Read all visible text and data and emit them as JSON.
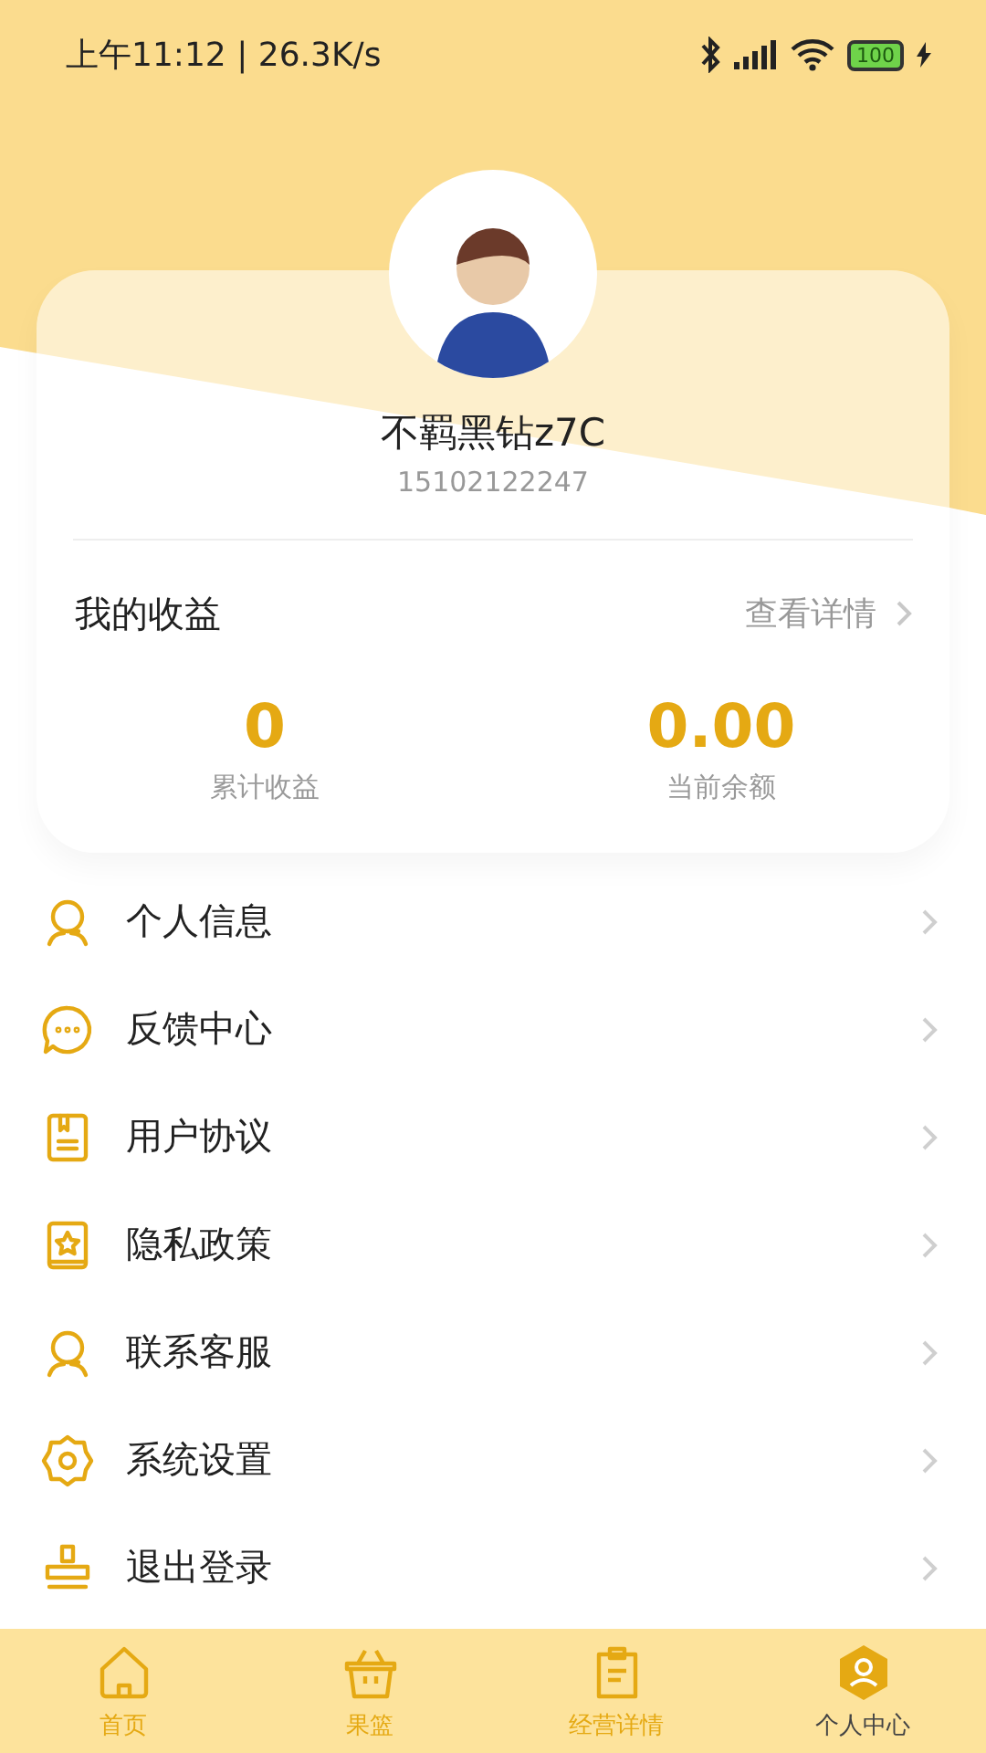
{
  "status_bar": {
    "time": "上午11:12 | 26.3K/s",
    "battery": "100"
  },
  "profile": {
    "name": "不羁黑钻z7C",
    "phone": "15102122247"
  },
  "earnings": {
    "title": "我的收益",
    "link": "查看详情",
    "stats": [
      {
        "value": "0",
        "label": "累计收益"
      },
      {
        "value": "0.00",
        "label": "当前余额"
      }
    ]
  },
  "menu": [
    {
      "kind": "person",
      "label": "个人信息"
    },
    {
      "kind": "chat",
      "label": "反馈中心"
    },
    {
      "kind": "doc",
      "label": "用户协议"
    },
    {
      "kind": "star",
      "label": "隐私政策"
    },
    {
      "kind": "person",
      "label": "联系客服"
    },
    {
      "kind": "gear",
      "label": "系统设置"
    },
    {
      "kind": "stamp",
      "label": "退出登录"
    }
  ],
  "tabs": [
    {
      "kind": "home",
      "label": "首页",
      "selected": false
    },
    {
      "kind": "basket",
      "label": "果篮",
      "selected": false
    },
    {
      "kind": "clipboard",
      "label": "经营详情",
      "selected": false
    },
    {
      "kind": "user",
      "label": "个人中心",
      "selected": true
    }
  ]
}
